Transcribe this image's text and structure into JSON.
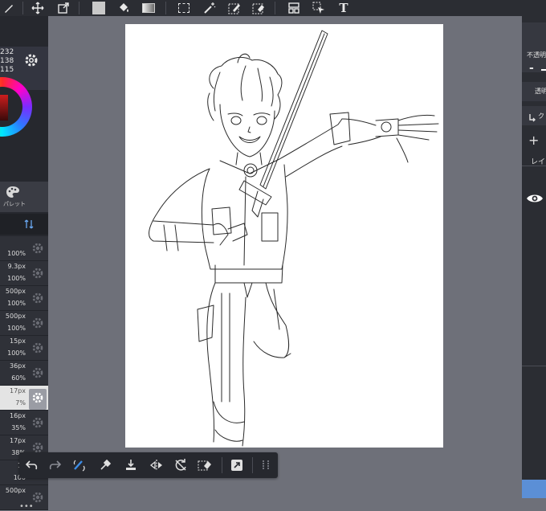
{
  "toolbar": {
    "icons": [
      "pen-icon",
      "move-icon",
      "transform-icon",
      "fill-color-icon",
      "bucket-icon",
      "gradient-icon",
      "select-rect-icon",
      "magic-wand-icon",
      "select-pen-icon",
      "select-eraser-icon",
      "panel-icon",
      "select-move-icon",
      "text-icon"
    ],
    "text_tool_label": "T"
  },
  "color_panel": {
    "rgb": [
      "232",
      "138",
      "115"
    ],
    "accent": "#e8201e"
  },
  "palette": {
    "label": "パレット"
  },
  "brushes": [
    {
      "size": "",
      "opacity": "100%"
    },
    {
      "size": "9.3px",
      "opacity": "100%"
    },
    {
      "size": "500px",
      "opacity": "100%"
    },
    {
      "size": "500px",
      "opacity": "100%"
    },
    {
      "size": "15px",
      "opacity": "100%"
    },
    {
      "size": "36px",
      "opacity": "60%"
    },
    {
      "size": "17px",
      "opacity": "7%",
      "selected": true
    },
    {
      "size": "16px",
      "opacity": "35%"
    },
    {
      "size": "17px",
      "opacity": "38%"
    },
    {
      "size": "18",
      "opacity": "100"
    },
    {
      "size": "500px",
      "opacity": ""
    }
  ],
  "more_label": "•••",
  "right_panel": {
    "opacity_label": "不透明",
    "minus_label": "-",
    "blend_label": "透明",
    "clip_label": "ク",
    "add_label": "+",
    "layer_label": "レイ"
  },
  "bottom_toolbar": {
    "icons": [
      "undo-icon",
      "redo-icon",
      "brush-swap-icon",
      "eyedropper-icon",
      "save-layer-icon",
      "flip-icon",
      "rotate-lock-icon",
      "erase-selection-icon",
      "fullscreen-icon",
      "grip-icon"
    ]
  }
}
